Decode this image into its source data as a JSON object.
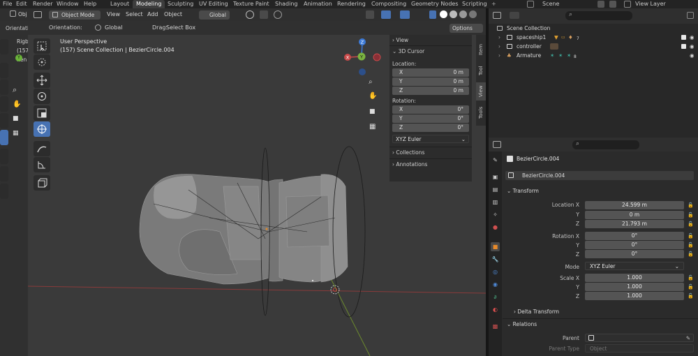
{
  "topbar": {
    "menus": [
      "File",
      "Edit",
      "Render",
      "Window",
      "Help"
    ],
    "workspaces": [
      "Layout",
      "Modeling",
      "Sculpting",
      "UV Editing",
      "Texture Paint",
      "Shading",
      "Animation",
      "Rendering",
      "Compositing",
      "Geometry Nodes",
      "Scripting"
    ],
    "active_workspace": "Modeling",
    "scene_label": "Scene",
    "view_layer_label": "View Layer"
  },
  "left_strip": {
    "mode_partial": "Obj",
    "orientation_partial": "Orientatio",
    "label_rigb": "Rigb",
    "label_157": "(157",
    "label_ren": "Ren"
  },
  "viewport": {
    "mode": "Object Mode",
    "menus": [
      "View",
      "Select",
      "Add",
      "Object"
    ],
    "transform_orientation": "Global",
    "orientation_label": "Orientation:",
    "orientation_value": "Global",
    "drag_label": "Drag:",
    "drag_value": "Select Box",
    "options_label": "Options",
    "perspective_label": "User Perspective",
    "collection_info": "(157) Scene Collection | BezierCircle.004",
    "gizmo": {
      "x": "X",
      "y": "Y",
      "z": "Z"
    }
  },
  "npanel": {
    "view_header": "View",
    "cursor_header": "3D Cursor",
    "location_label": "Location:",
    "location": [
      {
        "axis": "X",
        "value": "0 m"
      },
      {
        "axis": "Y",
        "value": "0 m"
      },
      {
        "axis": "Z",
        "value": "0 m"
      }
    ],
    "rotation_label": "Rotation:",
    "rotation": [
      {
        "axis": "X",
        "value": "0°"
      },
      {
        "axis": "Y",
        "value": "0°"
      },
      {
        "axis": "Z",
        "value": "0°"
      }
    ],
    "rotation_mode": "XYZ Euler",
    "collections_header": "Collections",
    "annotations_header": "Annotations",
    "tabs": [
      "Item",
      "Tool",
      "View",
      "Tools"
    ],
    "active_tab": "View"
  },
  "outliner": {
    "scene_collection": "Scene Collection",
    "items": [
      {
        "name": "spaceship1",
        "badge": "7"
      },
      {
        "name": "controller",
        "badge": ""
      },
      {
        "name": "Armature",
        "badge": "8"
      }
    ],
    "badge_8_small": "8"
  },
  "properties": {
    "object_name": "BezierCircle.004",
    "data_name": "BezierCircle.004",
    "transform_header": "Transform",
    "location_x_label": "Location X",
    "y_label": "Y",
    "z_label": "Z",
    "location": [
      "24.599 m",
      "0 m",
      "21.793 m"
    ],
    "rotation_x_label": "Rotation X",
    "rotation": [
      "0°",
      "0°",
      "0°"
    ],
    "mode_label": "Mode",
    "mode_value": "XYZ Euler",
    "scale_x_label": "Scale X",
    "scale": [
      "1.000",
      "1.000",
      "1.000"
    ],
    "delta_header": "Delta Transform",
    "relations_header": "Relations",
    "parent_label": "Parent",
    "parent_type_label": "Parent Type",
    "parent_type_value": "Object"
  }
}
